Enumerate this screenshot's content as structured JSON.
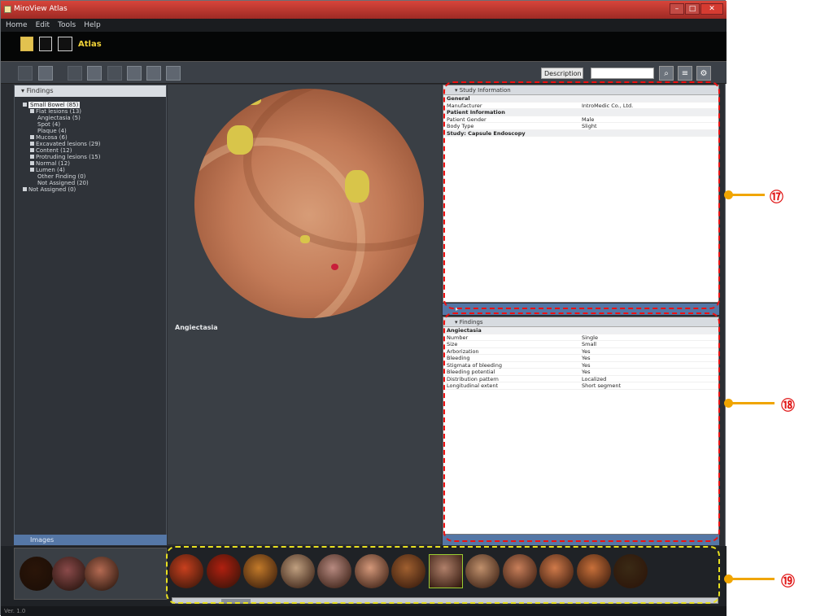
{
  "window": {
    "title": "MiroView Atlas",
    "controls": {
      "minimize": "–",
      "maximize": "□",
      "close": "✕"
    }
  },
  "menu": [
    "Home",
    "Edit",
    "Tools",
    "Help"
  ],
  "app_name": "Atlas",
  "toolbar": {
    "select_value": "Description",
    "search_placeholder": "",
    "search_icon": "search-icon"
  },
  "left_pane": {
    "header": "Findings",
    "tree": [
      {
        "label": "Small Bowel (85)",
        "level": 0,
        "selected": true
      },
      {
        "label": "Flat lesions (13)",
        "level": 1
      },
      {
        "label": "Angiectasia (5)",
        "level": 2
      },
      {
        "label": "Spot (4)",
        "level": 2
      },
      {
        "label": "Plaque (4)",
        "level": 2
      },
      {
        "label": "Mucosa (6)",
        "level": 1
      },
      {
        "label": "Excavated lesions (29)",
        "level": 1
      },
      {
        "label": "Content (12)",
        "level": 1
      },
      {
        "label": "Protruding lesions (15)",
        "level": 1
      },
      {
        "label": "Normal (12)",
        "level": 1
      },
      {
        "label": "Lumen (4)",
        "level": 1
      },
      {
        "label": "Other Finding (0)",
        "level": 2
      },
      {
        "label": "Not Assigned (20)",
        "level": 2
      },
      {
        "label": "Not Assigned (0)",
        "level": 0
      }
    ],
    "footer": "Images"
  },
  "viewer": {
    "caption": "Angiectasia"
  },
  "study_panel": {
    "header": "Study Information",
    "rows": [
      {
        "k": "General",
        "v": "",
        "section": true
      },
      {
        "k": "Manufacturer",
        "v": "IntroMedic Co., Ltd.",
        "section": false
      },
      {
        "k": "Patient Information",
        "v": "",
        "section": true
      },
      {
        "k": "Patient Gender",
        "v": "Male",
        "section": false
      },
      {
        "k": "Body Type",
        "v": "Slight",
        "section": false
      },
      {
        "k": "Study: Capsule Endoscopy",
        "v": "",
        "section": true
      }
    ]
  },
  "findings_panel": {
    "header": "Findings",
    "rows": [
      {
        "k": "Angiectasia",
        "v": "",
        "section": true
      },
      {
        "k": "Number",
        "v": "Single",
        "section": false
      },
      {
        "k": "Size",
        "v": "Small",
        "section": false
      },
      {
        "k": "Arborization",
        "v": "Yes",
        "section": false
      },
      {
        "k": "Bleeding",
        "v": "Yes",
        "section": false
      },
      {
        "k": "Stigmata of bleeding",
        "v": "Yes",
        "section": false
      },
      {
        "k": "Bleeding potential",
        "v": "Yes",
        "section": false
      },
      {
        "k": "Distribution pattern",
        "v": "Localized",
        "section": false
      },
      {
        "k": "Longitudinal extent",
        "v": "Short segment",
        "section": false
      }
    ]
  },
  "status_text": "Ver. 1.0",
  "callouts": [
    "⑰",
    "⑱",
    "⑲"
  ],
  "colors": {
    "highlight_red": "#e11111",
    "highlight_yellow": "#e8e020",
    "leader_orange": "#f0a500",
    "accent_gold": "#f1d238"
  },
  "thumbnails": [
    "#2a1508",
    "#8a4a4a",
    "#b46a52",
    "#c8401e",
    "#b02010",
    "#c27a2a",
    "#c0a080",
    "#b78a80",
    "#d4987a",
    "#a06030",
    "#b0806a",
    "#c0906c",
    "#c87f5a",
    "#d07a4a",
    "#c8703a",
    "#3a2a15"
  ]
}
